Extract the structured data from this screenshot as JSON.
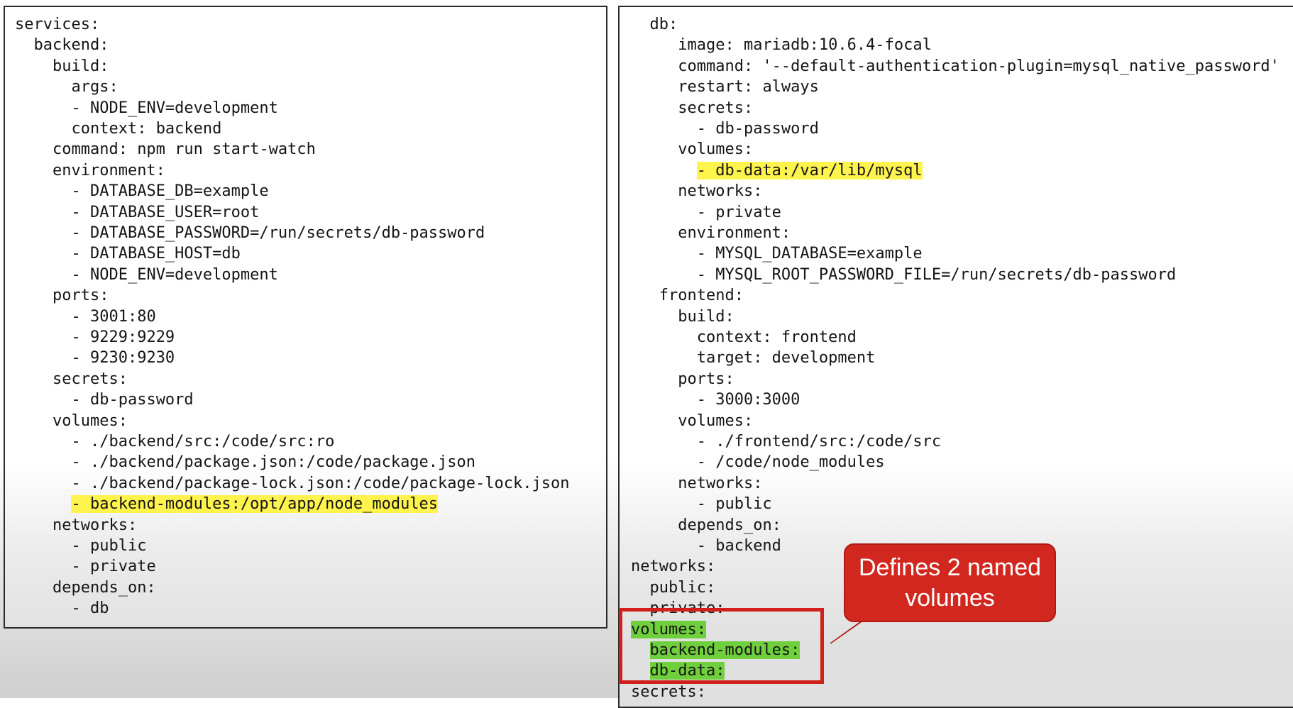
{
  "left_code": [
    "services:",
    "  backend:",
    "    build:",
    "      args:",
    "      - NODE_ENV=development",
    "      context: backend",
    "    command: npm run start-watch",
    "    environment:",
    "      - DATABASE_DB=example",
    "      - DATABASE_USER=root",
    "      - DATABASE_PASSWORD=/run/secrets/db-password",
    "      - DATABASE_HOST=db",
    "      - NODE_ENV=development",
    "    ports:",
    "      - 3001:80",
    "      - 9229:9229",
    "      - 9230:9230",
    "    secrets:",
    "      - db-password",
    "    volumes:",
    "      - ./backend/src:/code/src:ro",
    "      - ./backend/package.json:/code/package.json",
    "      - ./backend/package-lock.json:/code/package-lock.json",
    "      - backend-modules:/opt/app/node_modules",
    "    networks:",
    "      - public",
    "      - private",
    "    depends_on:",
    "      - db"
  ],
  "right_code": [
    "  db:",
    "     image: mariadb:10.6.4-focal",
    "     command: '--default-authentication-plugin=mysql_native_password'",
    "     restart: always",
    "     secrets:",
    "       - db-password",
    "     volumes:",
    "       - db-data:/var/lib/mysql",
    "     networks:",
    "       - private",
    "     environment:",
    "       - MYSQL_DATABASE=example",
    "       - MYSQL_ROOT_PASSWORD_FILE=/run/secrets/db-password",
    "   frontend:",
    "     build:",
    "       context: frontend",
    "       target: development",
    "     ports:",
    "       - 3000:3000",
    "     volumes:",
    "       - ./frontend/src:/code/src",
    "       - /code/node_modules",
    "     networks:",
    "       - public",
    "     depends_on:",
    "       - backend",
    "networks:",
    "  public:",
    "  private:",
    "volumes:",
    "  backend-modules:",
    "  db-data:",
    "secrets:"
  ],
  "highlights": {
    "left_yellow_line": "- backend-modules:/opt/app/node_modules",
    "right_yellow_line": "- db-data:/var/lib/mysql",
    "right_green_lines": [
      "volumes:",
      "backend-modules:",
      "db-data:"
    ]
  },
  "callout": {
    "text": "Defines 2 named volumes"
  },
  "colors": {
    "highlight_yellow": "#fff34d",
    "highlight_green": "#6fcf3c",
    "callout_red": "#d1271f",
    "box_red": "#d1201c"
  }
}
